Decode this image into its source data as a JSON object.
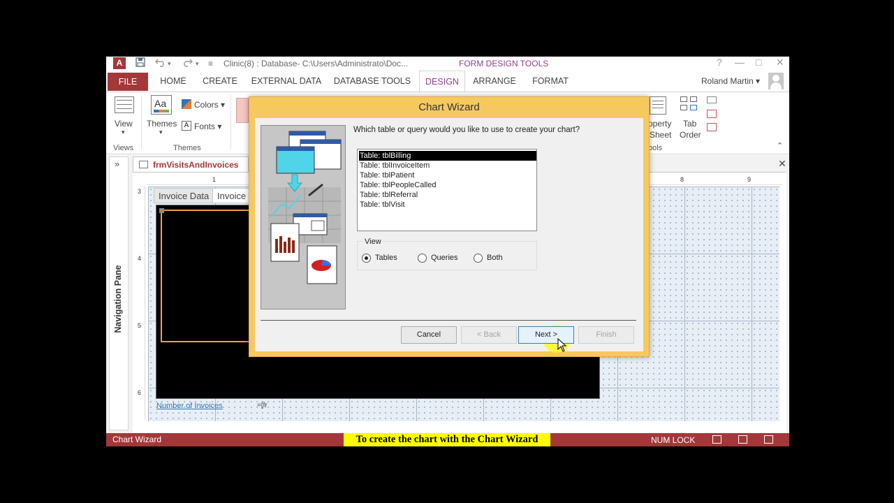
{
  "window": {
    "app_icon_letter": "A",
    "title": "Clinic(8) : Database- C:\\Users\\Administrato\\Doc...",
    "context_title": "FORM DESIGN TOOLS",
    "help": "?",
    "minimize": "—",
    "maximize": "□",
    "close": "✕"
  },
  "quick_access": {
    "save_icon": "save-icon",
    "undo_icon": "undo-icon",
    "redo_icon": "redo-icon",
    "customize": "≡"
  },
  "ribbon_tabs": [
    "FILE",
    "HOME",
    "CREATE",
    "EXTERNAL DATA",
    "DATABASE TOOLS",
    "DESIGN",
    "ARRANGE",
    "FORMAT"
  ],
  "user": {
    "name": "Roland Martin ▾"
  },
  "ribbon": {
    "view_label": "View",
    "view_arrow": "▾",
    "themes_label": "Themes",
    "themes_arrow": "▾",
    "themes_icon_text": "Aa",
    "colors_label": "Colors ▾",
    "fonts_label": "Fonts ▾",
    "groups": {
      "views": "Views",
      "themes": "Themes",
      "tools": "ools"
    },
    "property_sheet_line1": "operty",
    "property_sheet_line2": "Sheet",
    "tab_order_line1": "Tab",
    "tab_order_line2": "Order",
    "collapse": "⌃"
  },
  "nav_pane": {
    "label": "Navigation Pane",
    "toggle": "»"
  },
  "document": {
    "tab_label": "frmVisitsAndInvoices",
    "close": "✕",
    "ruler_top": [
      "1",
      "8",
      "9"
    ],
    "ruler_left": [
      "3",
      "4",
      "5",
      "6"
    ],
    "sub_tabs": [
      "Invoice Data",
      "Invoice"
    ],
    "field_label": "Number of Invoices",
    "field_expr": "=[fr"
  },
  "dialog": {
    "title": "Chart Wizard",
    "question": "Which table or query would you like to use to create your chart?",
    "tables": [
      "Table: tblBilling",
      "Table: tblInvoiceItem",
      "Table: tblPatient",
      "Table: tblPeopleCalled",
      "Table: tblReferral",
      "Table: tblVisit"
    ],
    "selected_index": 0,
    "view_group_label": "View",
    "view_options": [
      {
        "label": "Tables",
        "checked": true
      },
      {
        "label": "Queries",
        "checked": false
      },
      {
        "label": "Both",
        "checked": false
      }
    ],
    "buttons": {
      "cancel": "Cancel",
      "back": "< Back",
      "next": "Next >",
      "finish": "Finish"
    }
  },
  "status_bar": {
    "left_text": "Chart Wizard",
    "caption": "To create the chart with the Chart Wizard",
    "num_lock": "NUM LOCK"
  },
  "colors": {
    "access_red": "#a4373a",
    "context_purple": "#8e3f8e",
    "dialog_frame": "#f6c95f",
    "caption_bg": "#ffff00"
  }
}
